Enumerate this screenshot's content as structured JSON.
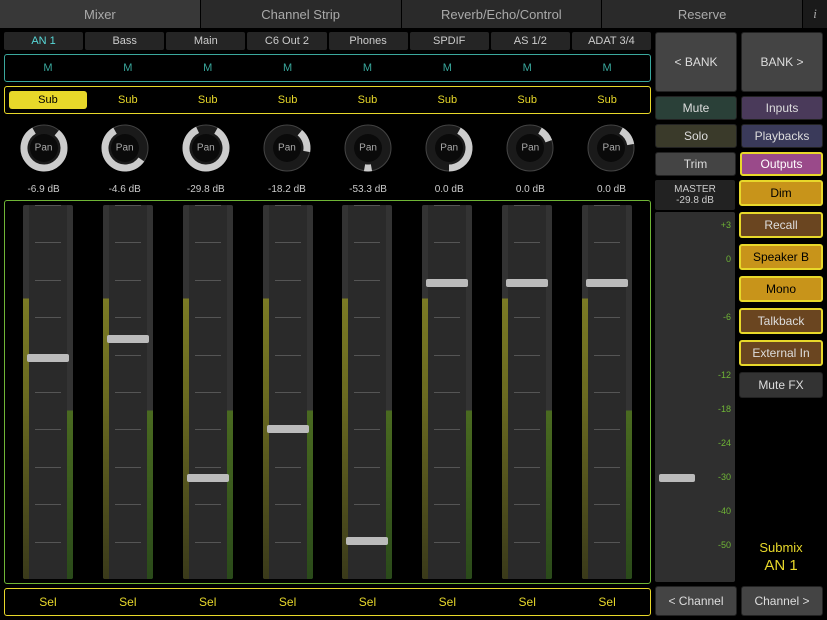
{
  "tabs": [
    "Mixer",
    "Channel Strip",
    "Reverb/Echo/Control",
    "Reserve"
  ],
  "active_tab": 0,
  "channels": [
    {
      "name": "AN 1",
      "mute": "M",
      "sub": "Sub",
      "sub_active": true,
      "pan": "Pan",
      "pan_start": 40,
      "pan_end": 330,
      "db": "-6.9 dB",
      "fader": 0.58,
      "sel": "Sel"
    },
    {
      "name": "Bass",
      "mute": "M",
      "sub": "Sub",
      "sub_active": false,
      "pan": "Pan",
      "pan_start": 125,
      "pan_end": 330,
      "db": "-4.6 dB",
      "fader": 0.63,
      "sel": "Sel"
    },
    {
      "name": "Main",
      "mute": "M",
      "sub": "Sub",
      "sub_active": false,
      "pan": "Pan",
      "pan_start": 30,
      "pan_end": 335,
      "db": "-29.8 dB",
      "fader": 0.26,
      "sel": "Sel"
    },
    {
      "name": "C6 Out 2",
      "mute": "M",
      "sub": "Sub",
      "sub_active": false,
      "pan": "Pan",
      "pan_start": 40,
      "pan_end": 100,
      "db": "-18.2 dB",
      "fader": 0.39,
      "sel": "Sel"
    },
    {
      "name": "Phones",
      "mute": "M",
      "sub": "Sub",
      "sub_active": false,
      "pan": "Pan",
      "pan_start": 170,
      "pan_end": 190,
      "db": "-53.3 dB",
      "fader": 0.09,
      "sel": "Sel"
    },
    {
      "name": "SPDIF",
      "mute": "M",
      "sub": "Sub",
      "sub_active": false,
      "pan": "Pan",
      "pan_start": 30,
      "pan_end": 180,
      "db": "0.0 dB",
      "fader": 0.78,
      "sel": "Sel"
    },
    {
      "name": "AS 1/2",
      "mute": "M",
      "sub": "Sub",
      "sub_active": false,
      "pan": "Pan",
      "pan_start": 30,
      "pan_end": 70,
      "db": "0.0 dB",
      "fader": 0.78,
      "sel": "Sel"
    },
    {
      "name": "ADAT 3/4",
      "mute": "M",
      "sub": "Sub",
      "sub_active": false,
      "pan": "Pan",
      "pan_start": 30,
      "pan_end": 80,
      "db": "0.0 dB",
      "fader": 0.78,
      "sel": "Sel"
    }
  ],
  "right": {
    "bank_prev": "< BANK",
    "bank_next": "BANK >",
    "mute": "Mute",
    "solo": "Solo",
    "trim": "Trim",
    "inputs": "Inputs",
    "playbacks": "Playbacks",
    "outputs": "Outputs",
    "dim": "Dim",
    "recall": "Recall",
    "speakerb": "Speaker B",
    "mono": "Mono",
    "talkback": "Talkback",
    "external": "External In",
    "mutefx": "Mute FX",
    "channel_prev": "< Channel",
    "channel_next": "Channel >"
  },
  "master": {
    "label": "MASTER",
    "db": "-29.8 dB",
    "scale": [
      "+3",
      "0",
      "",
      "-6",
      "",
      "-12",
      "-18",
      "-24",
      "-30",
      "-40",
      "-50",
      ""
    ],
    "fader": 0.27
  },
  "submix": {
    "label": "Submix",
    "name": "AN 1"
  }
}
